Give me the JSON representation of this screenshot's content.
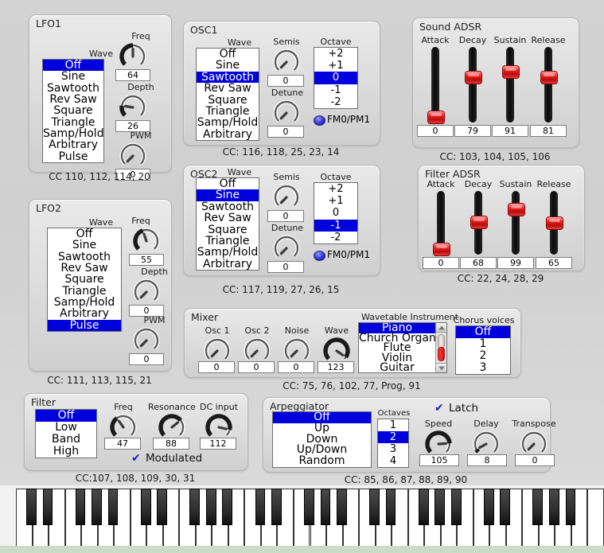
{
  "colors": {
    "select": "#0000dd",
    "slider_knob": "#ee1f1f",
    "led": "#2a2ad0",
    "check": "#1b1bd0"
  },
  "lfo1": {
    "title": "LFO1",
    "wave_label": "Wave",
    "wave_options": [
      "Off",
      "Sine",
      "Sawtooth",
      "Rev Saw",
      "Square",
      "Triangle",
      "Samp/Hold",
      "Arbitrary",
      "Pulse"
    ],
    "wave_selected": "Off",
    "knobs": [
      {
        "label": "Freq",
        "value": "64",
        "pct": 50
      },
      {
        "label": "Depth",
        "value": "26",
        "pct": 20
      },
      {
        "label": "PWM",
        "value": "0",
        "pct": 0
      }
    ],
    "cc": "CC 110, 112, 114, 20"
  },
  "lfo2": {
    "title": "LFO2",
    "wave_label": "Wave",
    "wave_options": [
      "Off",
      "Sine",
      "Sawtooth",
      "Rev Saw",
      "Square",
      "Triangle",
      "Samp/Hold",
      "Arbitrary",
      "Pulse"
    ],
    "wave_selected": "Pulse",
    "knobs": [
      {
        "label": "Freq",
        "value": "55",
        "pct": 43
      },
      {
        "label": "Depth",
        "value": "0",
        "pct": 0
      },
      {
        "label": "PWM",
        "value": "0",
        "pct": 0
      }
    ],
    "cc": "CC: 111, 113, 115, 21"
  },
  "osc1": {
    "title": "OSC1",
    "wave_label": "Wave",
    "wave_options": [
      "Off",
      "Sine",
      "Sawtooth",
      "Rev Saw",
      "Square",
      "Triangle",
      "Samp/Hold",
      "Arbitrary"
    ],
    "wave_selected": "Sawtooth",
    "semis_label": "Semis",
    "semis_value": "0",
    "semis_pct": 0,
    "detune_label": "Detune",
    "detune_value": "0",
    "detune_pct": 0,
    "octave_label": "Octave",
    "octave_options": [
      "+2",
      "+1",
      "0",
      "-1",
      "-2"
    ],
    "octave_selected": "0",
    "mod_label": "FM0/PM1",
    "cc": "CC: 116, 118, 25, 23, 14"
  },
  "osc2": {
    "title": "OSC2",
    "wave_label": "Wave",
    "wave_options": [
      "Off",
      "Sine",
      "Sawtooth",
      "Rev Saw",
      "Square",
      "Triangle",
      "Samp/Hold",
      "Arbitrary"
    ],
    "wave_selected": "Sine",
    "semis_label": "Semis",
    "semis_value": "0",
    "semis_pct": 0,
    "detune_label": "Detune",
    "detune_value": "0",
    "detune_pct": 0,
    "octave_label": "Octave",
    "octave_options": [
      "+2",
      "+1",
      "0",
      "-1",
      "-2"
    ],
    "octave_selected": "-1",
    "mod_label": "FM0/PM1",
    "cc": "CC: 117, 119, 27, 26, 15"
  },
  "sound_adsr": {
    "title": "Sound ADSR",
    "sliders": [
      {
        "label": "Attack",
        "value": "0",
        "pct": 0
      },
      {
        "label": "Decay",
        "value": "79",
        "pct": 62
      },
      {
        "label": "Sustain",
        "value": "91",
        "pct": 71
      },
      {
        "label": "Release",
        "value": "81",
        "pct": 63
      }
    ],
    "cc": "CC: 103, 104, 105, 106"
  },
  "filter_adsr": {
    "title": "Filter ADSR",
    "sliders": [
      {
        "label": "Attack",
        "value": "0",
        "pct": 0
      },
      {
        "label": "Decay",
        "value": "68",
        "pct": 53
      },
      {
        "label": "Sustain",
        "value": "99",
        "pct": 77
      },
      {
        "label": "Release",
        "value": "65",
        "pct": 51
      }
    ],
    "cc": "CC: 22, 24, 28, 29"
  },
  "mixer": {
    "title": "Mixer",
    "knobs": [
      {
        "label": "Osc 1",
        "value": "0",
        "pct": 0
      },
      {
        "label": "Osc 2",
        "value": "0",
        "pct": 0
      },
      {
        "label": "Noise",
        "value": "0",
        "pct": 0
      },
      {
        "label": "Wave",
        "value": "123",
        "pct": 96
      }
    ],
    "wavetable_label": "Wavetable Instrument",
    "wavetable_options": [
      "Piano",
      "Church Organ",
      "Flute",
      "Violin",
      "Guitar"
    ],
    "wavetable_selected": "Piano",
    "chorus_label": "Chorus voices",
    "chorus_options": [
      "Off",
      "1",
      "2",
      "3"
    ],
    "chorus_selected": "Off",
    "cc": "CC: 75, 76, 102, 77, Prog, 91"
  },
  "filter": {
    "title": "Filter",
    "type_options": [
      "Off",
      "Low",
      "Band",
      "High"
    ],
    "type_selected": "Off",
    "knobs": [
      {
        "label": "Freq",
        "value": "47",
        "pct": 37
      },
      {
        "label": "Resonance",
        "value": "88",
        "pct": 69
      },
      {
        "label": "DC input",
        "value": "112",
        "pct": 88
      }
    ],
    "modulated_label": "Modulated",
    "modulated_checked": true,
    "cc": "CC:107, 108, 109, 30, 31"
  },
  "arpeggiator": {
    "title": "Arpeggiator",
    "mode_options": [
      "Off",
      "Up",
      "Down",
      "Up/Down",
      "Random"
    ],
    "mode_selected": "Off",
    "octaves_label": "Octaves",
    "octaves_options": [
      "1",
      "2",
      "3",
      "4"
    ],
    "octaves_selected": "2",
    "latch_label": "Latch",
    "latch_checked": true,
    "knobs": [
      {
        "label": "Speed",
        "value": "105",
        "pct": 82
      },
      {
        "label": "Delay",
        "value": "8",
        "pct": 6
      },
      {
        "label": "Transpose",
        "value": "0",
        "pct": 0
      }
    ],
    "cc": "CC: 85, 86, 87, 88, 89, 90"
  },
  "keyboard": {
    "white_keys": 36,
    "name": "piano-keyboard"
  }
}
